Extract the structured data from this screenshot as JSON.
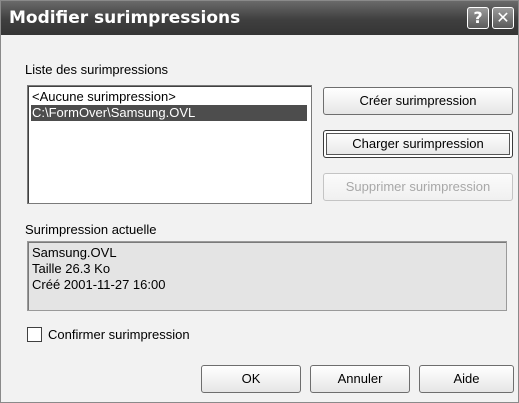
{
  "window": {
    "title": "Modifier surimpressions",
    "help_glyph": "?",
    "close_glyph": "✕"
  },
  "overlay_list": {
    "label": "Liste des surimpressions",
    "items": [
      {
        "text": "<Aucune surimpression>",
        "selected": false
      },
      {
        "text": "C:\\FormOver\\Samsung.OVL",
        "selected": true
      }
    ]
  },
  "buttons": {
    "create": "Créer surimpression",
    "load": "Charger surimpression",
    "delete": "Supprimer surimpression",
    "ok": "OK",
    "cancel": "Annuler",
    "help": "Aide"
  },
  "current_overlay": {
    "label": "Surimpression actuelle",
    "name": "Samsung.OVL",
    "size": "Taille 26.3 Ko",
    "created": "Créé 2001-11-27 16:00"
  },
  "confirm": {
    "label": "Confirmer surimpression",
    "checked": false
  },
  "icons": {
    "help": "help-icon",
    "close": "close-icon"
  }
}
